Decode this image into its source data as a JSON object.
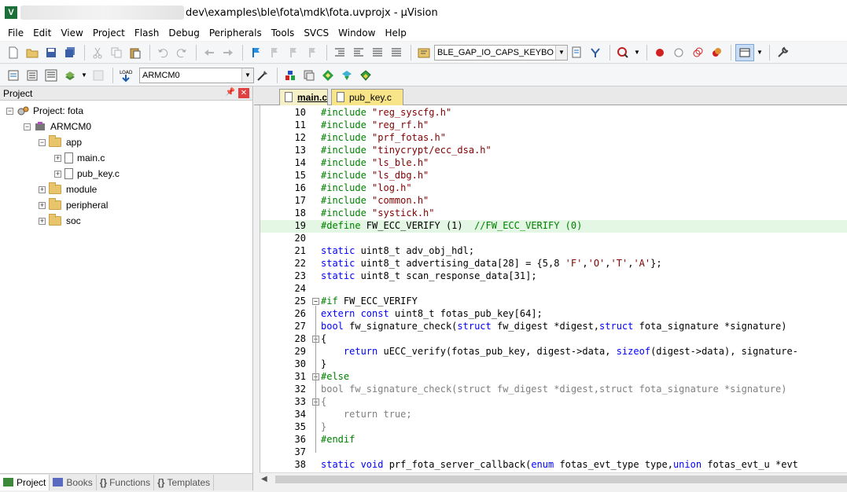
{
  "window": {
    "title": "dev\\examples\\ble\\fota\\mdk\\fota.uvprojx - µVision",
    "logo": "V"
  },
  "menu": [
    "File",
    "Edit",
    "View",
    "Project",
    "Flash",
    "Debug",
    "Peripherals",
    "Tools",
    "SVCS",
    "Window",
    "Help"
  ],
  "toolbar": {
    "find_combo": "BLE_GAP_IO_CAPS_KEYBO",
    "target_combo": "ARMCM0"
  },
  "project_panel": {
    "title": "Project",
    "tree": {
      "root": "Project: fota",
      "target": "ARMCM0",
      "group_app": "app",
      "file1": "main.c",
      "file2": "pub_key.c",
      "group_module": "module",
      "group_peripheral": "peripheral",
      "group_soc": "soc"
    },
    "tabs": [
      "Project",
      "Books",
      "Functions",
      "Templates"
    ],
    "tab_icons": [
      "project-tab-icon",
      "books-tab-icon",
      "functions-tab-icon",
      "templates-tab-icon"
    ]
  },
  "editor": {
    "tabs": [
      "main.c",
      "pub_key.c"
    ],
    "active_tab": "main.c",
    "tab_colors": {
      "main": "#f5f0c8",
      "pub_key": "#f8e58a"
    },
    "highlight_line": "19",
    "lines": [
      {
        "n": "10",
        "t": [
          [
            "pp",
            "#include "
          ],
          [
            "str",
            "\"reg_syscfg.h\""
          ]
        ]
      },
      {
        "n": "11",
        "t": [
          [
            "pp",
            "#include "
          ],
          [
            "str",
            "\"reg_rf.h\""
          ]
        ]
      },
      {
        "n": "12",
        "t": [
          [
            "pp",
            "#include "
          ],
          [
            "str",
            "\"prf_fotas.h\""
          ]
        ]
      },
      {
        "n": "13",
        "t": [
          [
            "pp",
            "#include "
          ],
          [
            "str",
            "\"tinycrypt/ecc_dsa.h\""
          ]
        ]
      },
      {
        "n": "14",
        "t": [
          [
            "pp",
            "#include "
          ],
          [
            "str",
            "\"ls_ble.h\""
          ]
        ]
      },
      {
        "n": "15",
        "t": [
          [
            "pp",
            "#include "
          ],
          [
            "str",
            "\"ls_dbg.h\""
          ]
        ]
      },
      {
        "n": "16",
        "t": [
          [
            "pp",
            "#include "
          ],
          [
            "str",
            "\"log.h\""
          ]
        ]
      },
      {
        "n": "17",
        "t": [
          [
            "pp",
            "#include "
          ],
          [
            "str",
            "\"common.h\""
          ]
        ]
      },
      {
        "n": "18",
        "t": [
          [
            "pp",
            "#include "
          ],
          [
            "str",
            "\"systick.h\""
          ]
        ]
      },
      {
        "n": "19",
        "t": [
          [
            "pp",
            "#define "
          ],
          [
            "",
            "FW_ECC_VERIFY (1)  "
          ],
          [
            "cm",
            "//FW_ECC_VERIFY (0)"
          ]
        ]
      },
      {
        "n": "20",
        "t": []
      },
      {
        "n": "21",
        "t": [
          [
            "kw",
            "static "
          ],
          [
            "",
            "uint8_t adv_obj_hdl;"
          ]
        ]
      },
      {
        "n": "22",
        "t": [
          [
            "kw",
            "static "
          ],
          [
            "",
            "uint8_t advertising_data[28] = {5,8 "
          ],
          [
            "str",
            "'F'"
          ],
          [
            "",
            ","
          ],
          [
            "str",
            "'O'"
          ],
          [
            "",
            ","
          ],
          [
            "str",
            "'T'"
          ],
          [
            "",
            ","
          ],
          [
            "str",
            "'A'"
          ],
          [
            "",
            "};"
          ]
        ]
      },
      {
        "n": "23",
        "t": [
          [
            "kw",
            "static "
          ],
          [
            "",
            "uint8_t scan_response_data[31];"
          ]
        ]
      },
      {
        "n": "24",
        "t": []
      },
      {
        "n": "25",
        "t": [
          [
            "pp",
            "#if "
          ],
          [
            "",
            "FW_ECC_VERIFY"
          ]
        ]
      },
      {
        "n": "26",
        "t": [
          [
            "kw",
            "extern const "
          ],
          [
            "",
            "uint8_t fotas_pub_key[64];"
          ]
        ]
      },
      {
        "n": "27",
        "t": [
          [
            "kw",
            "bool "
          ],
          [
            "",
            "fw_signature_check("
          ],
          [
            "kw",
            "struct "
          ],
          [
            "",
            "fw_digest *digest,"
          ],
          [
            "kw",
            "struct "
          ],
          [
            "",
            "fota_signature *signature)"
          ]
        ]
      },
      {
        "n": "28",
        "t": [
          [
            "",
            "{"
          ]
        ]
      },
      {
        "n": "29",
        "t": [
          [
            "",
            "    "
          ],
          [
            "kw",
            "return "
          ],
          [
            "",
            "uECC_verify(fotas_pub_key, digest->data, "
          ],
          [
            "kw",
            "sizeof"
          ],
          [
            "",
            "(digest->data), signature-"
          ]
        ]
      },
      {
        "n": "30",
        "t": [
          [
            "",
            "}"
          ]
        ]
      },
      {
        "n": "31",
        "t": [
          [
            "pp",
            "#else"
          ]
        ]
      },
      {
        "n": "32",
        "t": [
          [
            "gry",
            "bool fw_signature_check(struct fw_digest *digest,struct fota_signature *signature)"
          ]
        ]
      },
      {
        "n": "33",
        "t": [
          [
            "gry",
            "{"
          ]
        ]
      },
      {
        "n": "34",
        "t": [
          [
            "gry",
            "    return true;"
          ]
        ]
      },
      {
        "n": "35",
        "t": [
          [
            "gry",
            "}"
          ]
        ]
      },
      {
        "n": "36",
        "t": [
          [
            "pp",
            "#endif"
          ]
        ]
      },
      {
        "n": "37",
        "t": []
      },
      {
        "n": "38",
        "t": [
          [
            "kw",
            "static void "
          ],
          [
            "",
            "prf_fota_server_callback("
          ],
          [
            "kw",
            "enum "
          ],
          [
            "",
            "fotas_evt_type type,"
          ],
          [
            "kw",
            "union "
          ],
          [
            "",
            "fotas_evt_u *evt"
          ]
        ]
      }
    ]
  }
}
